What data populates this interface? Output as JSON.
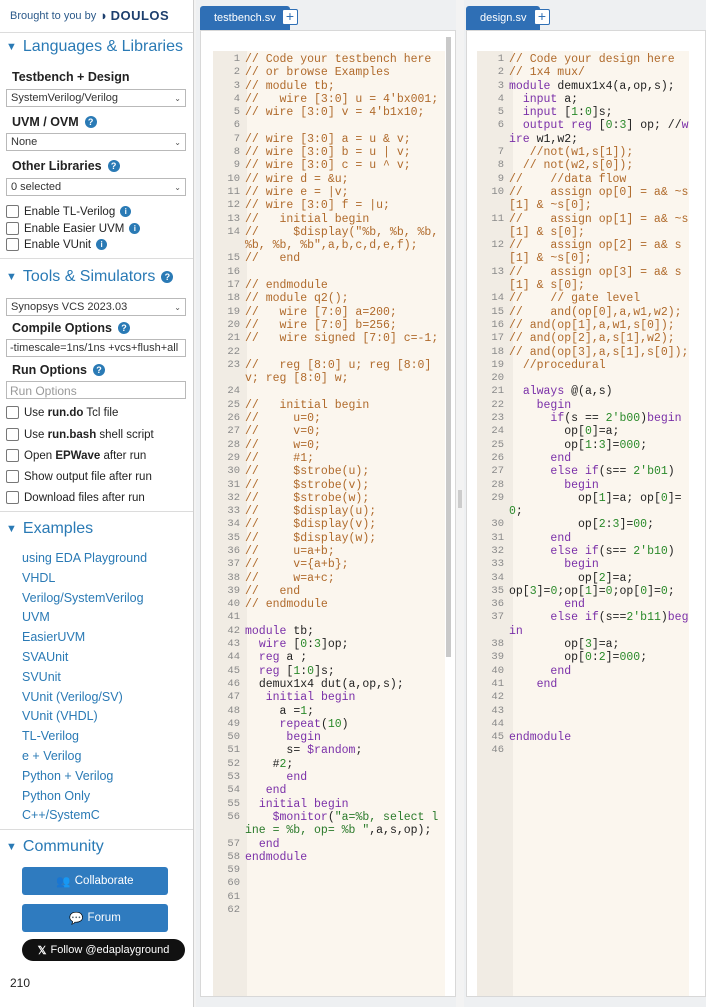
{
  "sidebar": {
    "brought_by": "Brought to you by",
    "brand": "DOULOS",
    "languages_title": "Languages & Libraries",
    "testbench_design_label": "Testbench + Design",
    "language_select": "SystemVerilog/Verilog",
    "uvm_label": "UVM / OVM",
    "uvm_select": "None",
    "other_libraries_label": "Other Libraries",
    "other_libraries_select": "0 selected",
    "enable_tl_verilog": "Enable TL-Verilog",
    "enable_easier_uvm": "Enable Easier UVM",
    "enable_vunit": "Enable VUnit",
    "tools_title": "Tools & Simulators",
    "simulator_select": "Synopsys VCS 2023.03",
    "compile_options_label": "Compile Options",
    "compile_options_value": "-timescale=1ns/1ns +vcs+flush+all",
    "run_options_label": "Run Options",
    "run_options_placeholder": "Run Options",
    "opt_run_do_pre": "Use ",
    "opt_run_do_bold": "run.do",
    "opt_run_do_post": " Tcl file",
    "opt_run_bash_pre": "Use ",
    "opt_run_bash_bold": "run.bash",
    "opt_run_bash_post": " shell script",
    "opt_epwave_pre": "Open ",
    "opt_epwave_bold": "EPWave",
    "opt_epwave_post": " after run",
    "opt_show_output": "Show output file after run",
    "opt_download": "Download files after run",
    "examples_title": "Examples",
    "examples": [
      "using EDA Playground",
      "VHDL",
      "Verilog/SystemVerilog",
      "UVM",
      "EasierUVM",
      "SVAUnit",
      "SVUnit",
      "VUnit (Verilog/SV)",
      "VUnit (VHDL)",
      "TL-Verilog",
      "e + Verilog",
      "Python + Verilog",
      "Python Only",
      "C++/SystemC"
    ],
    "community_title": "Community",
    "collaborate": "Collaborate",
    "forum": "Forum",
    "follow": "Follow @edaplayground",
    "count": "210"
  },
  "testbench": {
    "tab": "testbench.sv",
    "lines": [
      [
        "1",
        "// Code your testbench here"
      ],
      [
        "2",
        "// or browse Examples"
      ],
      [
        "3",
        "// module tb;"
      ],
      [
        "4",
        "//   wire [3:0] u = 4'bx001;"
      ],
      [
        "5",
        "// wire [3:0] v = 4'b1x10;"
      ],
      [
        "6",
        ""
      ],
      [
        "7",
        "// wire [3:0] a = u & v;"
      ],
      [
        "8",
        "// wire [3:0] b = u | v;"
      ],
      [
        "9",
        "// wire [3:0] c = u ^ v;"
      ],
      [
        "10",
        "// wire d = &u;"
      ],
      [
        "11",
        "// wire e = |v;"
      ],
      [
        "12",
        "// wire [3:0] f = |u;"
      ],
      [
        "13",
        "//   initial begin"
      ],
      [
        "14",
        "//     $display(\"%b, %b, %b, %b, %b, %b\",a,b,c,d,e,f);"
      ],
      [
        "15",
        "//   end"
      ],
      [
        "16",
        ""
      ],
      [
        "17",
        "// endmodule"
      ],
      [
        "18",
        "// module q2();"
      ],
      [
        "19",
        "//   wire [7:0] a=200;"
      ],
      [
        "20",
        "//   wire [7:0] b=256;"
      ],
      [
        "21",
        "//   wire signed [7:0] c=-1;"
      ],
      [
        "22",
        ""
      ],
      [
        "23",
        "//   reg [8:0] u; reg [8:0] v; reg [8:0] w;"
      ],
      [
        "24",
        ""
      ],
      [
        "25",
        "//   initial begin"
      ],
      [
        "26",
        "//     u=0;"
      ],
      [
        "27",
        "//     v=0;"
      ],
      [
        "28",
        "//     w=0;"
      ],
      [
        "29",
        "//     #1;"
      ],
      [
        "30",
        "//     $strobe(u);"
      ],
      [
        "31",
        "//     $strobe(v);"
      ],
      [
        "32",
        "//     $strobe(w);"
      ],
      [
        "33",
        "//     $display(u);"
      ],
      [
        "34",
        "//     $display(v);"
      ],
      [
        "35",
        "//     $display(w);"
      ],
      [
        "36",
        "//     u=a+b;"
      ],
      [
        "37",
        "//     v={a+b};"
      ],
      [
        "38",
        "//     w=a+c;"
      ],
      [
        "39",
        "//   end"
      ],
      [
        "40",
        "// endmodule"
      ],
      [
        "41",
        ""
      ],
      [
        "42",
        "module tb;"
      ],
      [
        "43",
        "  wire [0:3]op;"
      ],
      [
        "44",
        "  reg a ;"
      ],
      [
        "45",
        "  reg [1:0]s;"
      ],
      [
        "46",
        "  demux1x4 dut(a,op,s);"
      ],
      [
        "47",
        "   initial begin"
      ],
      [
        "48",
        "     a =1;"
      ],
      [
        "49",
        "     repeat(10)"
      ],
      [
        "50",
        "      begin"
      ],
      [
        "51",
        "      s= $random;"
      ],
      [
        "52",
        "    #2;"
      ],
      [
        "53",
        "      end"
      ],
      [
        "54",
        "   end"
      ],
      [
        "55",
        "  initial begin"
      ],
      [
        "56",
        "    $monitor(\"a=%b, select line = %b, op= %b \",a,s,op);"
      ],
      [
        "57",
        "  end"
      ],
      [
        "58",
        "endmodule"
      ],
      [
        "59",
        ""
      ],
      [
        "60",
        ""
      ],
      [
        "61",
        ""
      ],
      [
        "62",
        ""
      ]
    ]
  },
  "design": {
    "tab": "design.sv",
    "lines": [
      [
        "1",
        "// Code your design here"
      ],
      [
        "2",
        "// 1x4 mux/"
      ],
      [
        "3",
        "module demux1x4(a,op,s);"
      ],
      [
        "4",
        "  input a;"
      ],
      [
        "5",
        "  input [1:0]s;"
      ],
      [
        "6",
        "  output reg [0:3] op; //wire w1,w2;"
      ],
      [
        "7",
        "   //not(w1,s[1]);"
      ],
      [
        "8",
        "  // not(w2,s[0]);"
      ],
      [
        "9",
        "//    //data flow"
      ],
      [
        "10",
        "//    assign op[0] = a& ~s[1] & ~s[0];"
      ],
      [
        "11",
        "//    assign op[1] = a& ~s[1] & s[0];"
      ],
      [
        "12",
        "//    assign op[2] = a& s[1] & ~s[0];"
      ],
      [
        "13",
        "//    assign op[3] = a& s[1] & s[0];"
      ],
      [
        "14",
        "//    // gate level"
      ],
      [
        "15",
        "//    and(op[0],a,w1,w2);"
      ],
      [
        "16",
        "// and(op[1],a,w1,s[0]);"
      ],
      [
        "17",
        "// and(op[2],a,s[1],w2);"
      ],
      [
        "18",
        "// and(op[3],a,s[1],s[0]);"
      ],
      [
        "19",
        "  //procedural"
      ],
      [
        "20",
        ""
      ],
      [
        "21",
        "  always @(a,s)"
      ],
      [
        "22",
        "    begin"
      ],
      [
        "23",
        "      if(s == 2'b00)begin"
      ],
      [
        "24",
        "        op[0]=a;"
      ],
      [
        "25",
        "        op[1:3]=000;"
      ],
      [
        "26",
        "      end"
      ],
      [
        "27",
        "      else if(s== 2'b01)"
      ],
      [
        "28",
        "        begin"
      ],
      [
        "29",
        "          op[1]=a; op[0]=0;"
      ],
      [
        "30",
        "          op[2:3]=00;"
      ],
      [
        "31",
        "      end"
      ],
      [
        "32",
        "      else if(s== 2'b10)"
      ],
      [
        "33",
        "        begin"
      ],
      [
        "34",
        "          op[2]=a;"
      ],
      [
        "35",
        "op[3]=0;op[1]=0;op[0]=0;"
      ],
      [
        "36",
        "        end"
      ],
      [
        "37",
        "      else if(s==2'b11)begin"
      ],
      [
        "38",
        "        op[3]=a;"
      ],
      [
        "39",
        "        op[0:2]=000;"
      ],
      [
        "40",
        "      end"
      ],
      [
        "41",
        "    end"
      ],
      [
        "42",
        ""
      ],
      [
        "43",
        ""
      ],
      [
        "44",
        ""
      ],
      [
        "45",
        "endmodule"
      ],
      [
        "46",
        ""
      ]
    ]
  }
}
